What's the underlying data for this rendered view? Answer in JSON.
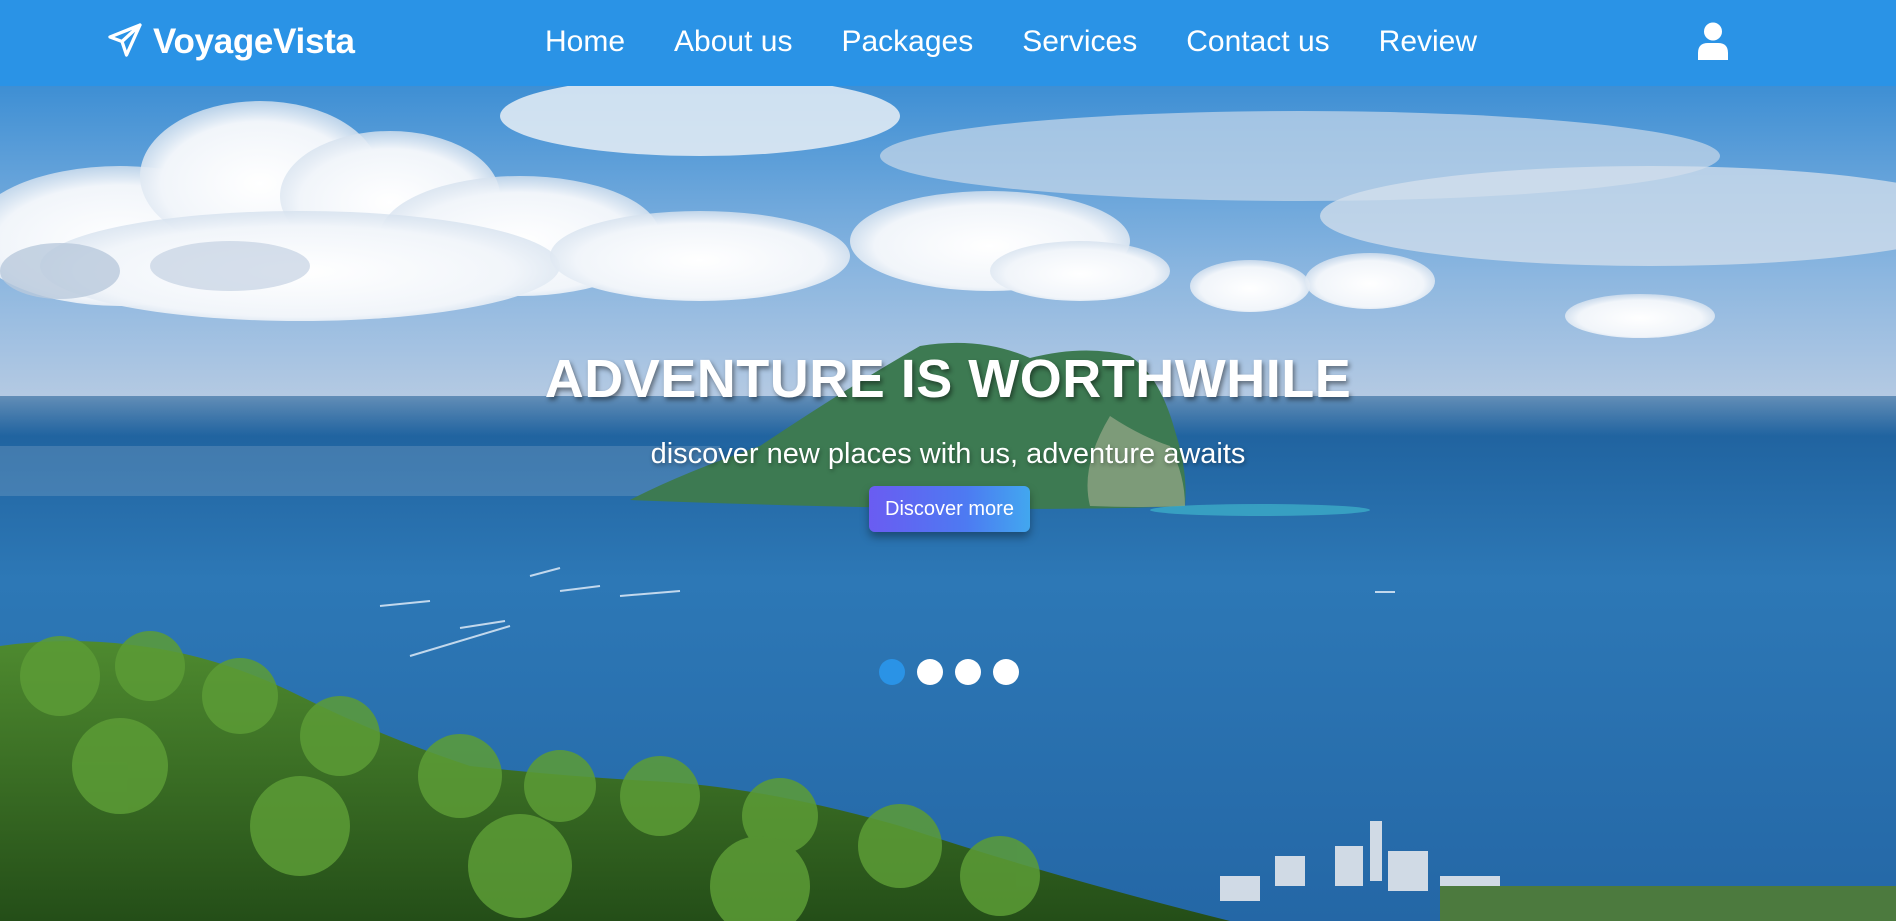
{
  "brand": {
    "name": "VoyageVista",
    "icon": "paper-plane-icon"
  },
  "nav": {
    "items": [
      {
        "label": "Home"
      },
      {
        "label": "About us"
      },
      {
        "label": "Packages"
      },
      {
        "label": "Services"
      },
      {
        "label": "Contact us"
      },
      {
        "label": "Review"
      }
    ],
    "user_icon": "user-icon"
  },
  "hero": {
    "title": "ADVENTURE IS WORTHWHILE",
    "subtitle": "discover new places with us, adventure awaits",
    "cta_label": "Discover more",
    "slides_total": 4,
    "active_slide": 1
  },
  "colors": {
    "primary": "#2a93e6",
    "cta_start": "#6a5cf2",
    "cta_end": "#42a7ef",
    "text": "#ffffff"
  }
}
